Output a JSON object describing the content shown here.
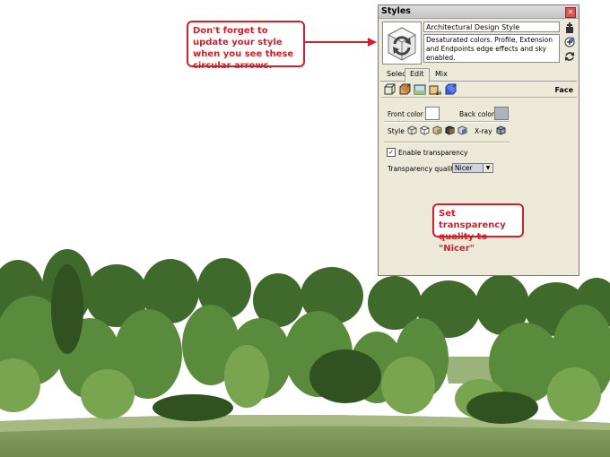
{
  "window": {
    "title": "Styles",
    "close_glyph": "✕"
  },
  "style": {
    "name": "Architectural Design Style",
    "description": "Desaturated colors. Profile, Extension and Endpoints edge effects and sky enabled."
  },
  "tabs": [
    {
      "label": "Select",
      "active": false
    },
    {
      "label": "Edit",
      "active": true
    },
    {
      "label": "Mix",
      "active": false
    }
  ],
  "edit": {
    "section_label": "Face",
    "front_color_label": "Front color",
    "front_color": "#ffffff",
    "back_color_label": "Back color",
    "back_color": "#a9b4bd",
    "style_label": "Style",
    "xray_label": "X-ray",
    "enable_transparency_label": "Enable transparency",
    "enable_transparency_checked": true,
    "transparency_quality_label": "Transparency quality:",
    "transparency_quality_value": "Nicer"
  },
  "callouts": {
    "refresh_note": "Don't forget to update your style when you see these circular arrows.",
    "quality_note": "Set transparency quality to \"Nicer\""
  },
  "colors": {
    "callout_red": "#d0202a",
    "window_bg": "#ece9d8"
  },
  "icons": [
    "refresh-icon",
    "create-style-icon",
    "update-style-icon",
    "edge-settings-icon",
    "face-settings-icon",
    "background-settings-icon",
    "watermark-settings-icon",
    "modeling-settings-icon",
    "wireframe-icon",
    "hidden-line-icon",
    "shaded-icon",
    "shaded-textures-icon",
    "monochrome-icon",
    "xray-icon"
  ]
}
